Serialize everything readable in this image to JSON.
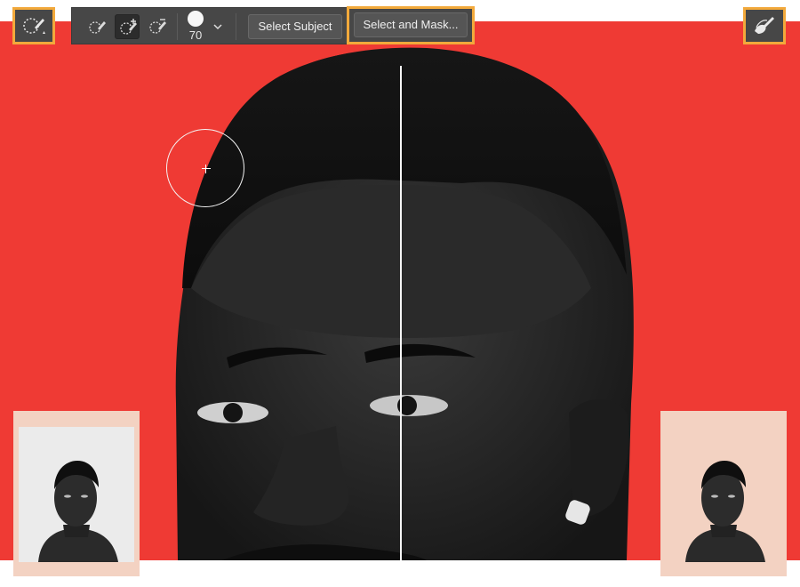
{
  "toolbar": {
    "left_tool_icon": "quick-selection-brush-icon",
    "right_tool_icon": "refine-edge-brush-icon",
    "mode_icons": [
      "new-selection-brush-icon",
      "add-to-selection-brush-icon",
      "subtract-from-selection-brush-icon"
    ],
    "active_mode_index": 1,
    "brush_size": "70",
    "select_subject_label": "Select Subject",
    "select_and_mask_label": "Select and Mask..."
  },
  "colors": {
    "highlight": "#f2a93b",
    "canvas_background": "#ef3a34",
    "toolbar_background": "#474747",
    "thumbnail_card": "#f3d2c2"
  },
  "thumbnails": {
    "left": {
      "subject": "portrait-original-gray-background"
    },
    "right": {
      "subject": "portrait-on-peach-background"
    }
  }
}
